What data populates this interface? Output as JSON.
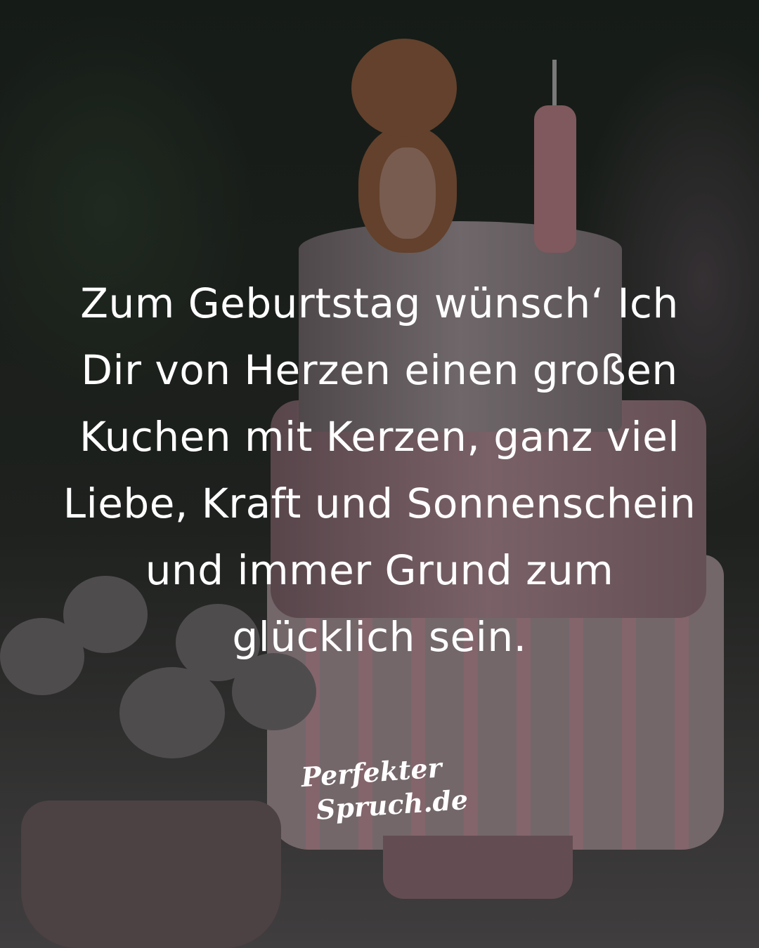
{
  "quote": {
    "lines": [
      "Zum Geburtstag wünsch‘ Ich",
      "Dir von Herzen einen großen",
      "Kuchen mit Kerzen, ganz viel",
      "Liebe, Kraft und Sonnenschein",
      "und immer Grund zum",
      "glücklich sein."
    ]
  },
  "logo": {
    "line1": "Perfekter",
    "line2": "Spruch.de"
  }
}
